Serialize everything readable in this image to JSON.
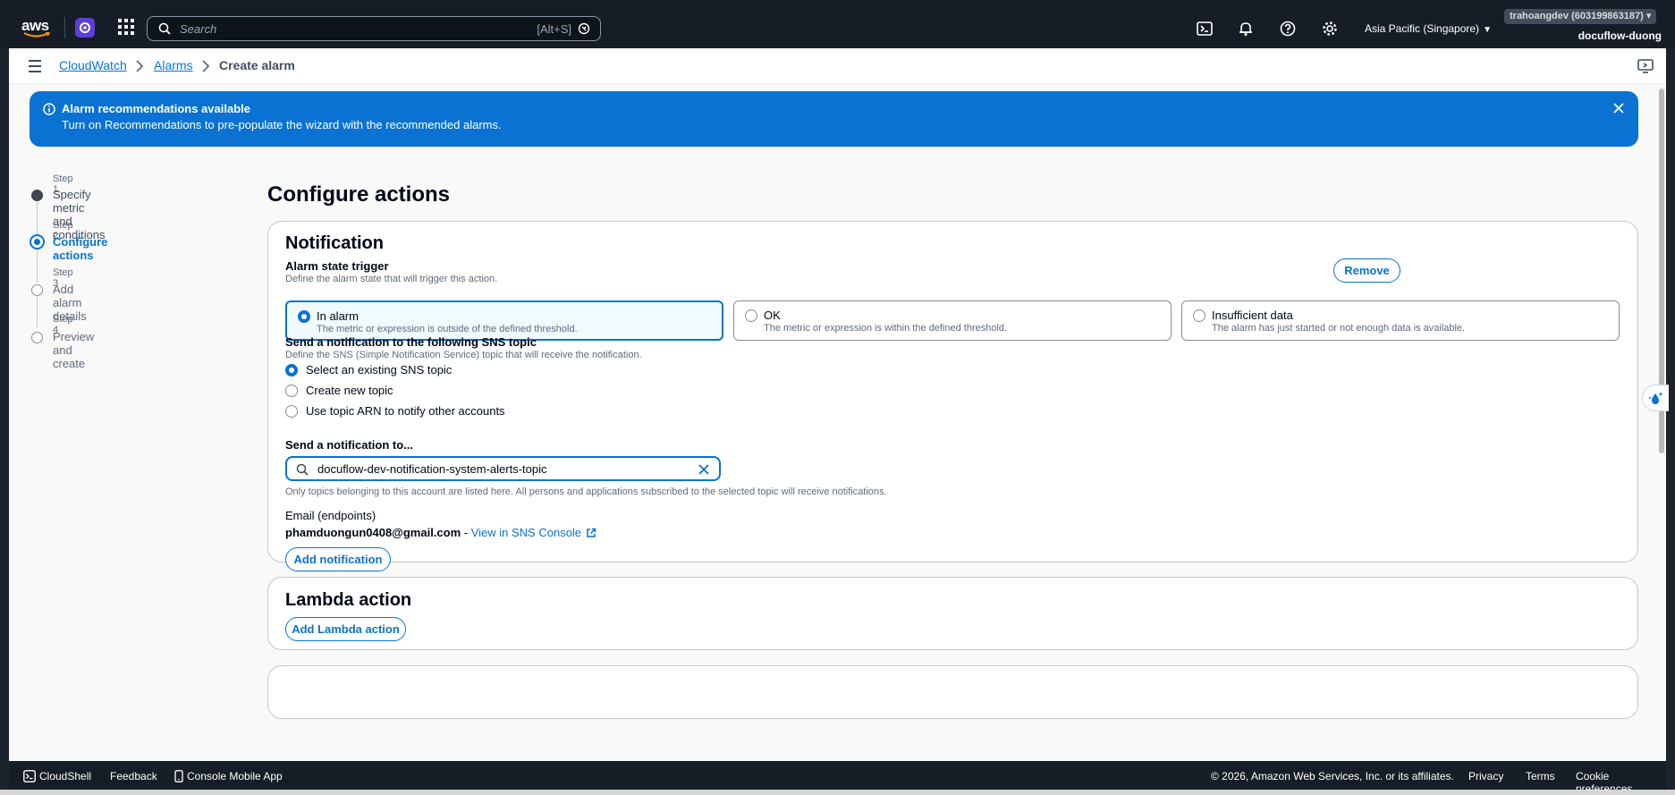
{
  "topnav": {
    "logo": "aws",
    "search_placeholder": "Search",
    "search_shortcut": "[Alt+S]",
    "region": "Asia Pacific (Singapore)",
    "account": "trahoangdev (603199863187)",
    "account_sub": "docuflow-duong",
    "icons": [
      "cloudshell-icon",
      "bell-icon",
      "help-icon",
      "gear-icon"
    ]
  },
  "breadcrumb": {
    "items": [
      "CloudWatch",
      "Alarms"
    ],
    "current": "Create alarm"
  },
  "flash": {
    "title": "Alarm recommendations available",
    "message": "Turn on Recommendations to pre-populate the wizard with the recommended alarms.",
    "color": "#0972d3"
  },
  "steps": [
    {
      "num": "Step 1",
      "label": "Specify metric and conditions",
      "state": "done"
    },
    {
      "num": "Step 2",
      "label": "Configure actions",
      "state": "current"
    },
    {
      "num": "Step 3",
      "label": "Add alarm details",
      "state": "upcoming"
    },
    {
      "num": "Step 4",
      "label": "Preview and create",
      "state": "upcoming"
    }
  ],
  "page_title": "Configure actions",
  "notification": {
    "heading": "Notification",
    "remove_label": "Remove",
    "trigger_label": "Alarm state trigger",
    "trigger_desc": "Define the alarm state that will trigger this action.",
    "states": [
      {
        "title": "In alarm",
        "desc": "The metric or expression is outside of the defined threshold.",
        "selected": true
      },
      {
        "title": "OK",
        "desc": "The metric or expression is within the defined threshold.",
        "selected": false
      },
      {
        "title": "Insufficient data",
        "desc": "The alarm has just started or not enough data is available.",
        "selected": false
      }
    ],
    "sns_label": "Send a notification to the following SNS topic",
    "sns_desc": "Define the SNS (Simple Notification Service) topic that will receive the notification.",
    "sns_options": [
      {
        "label": "Select an existing SNS topic",
        "selected": true
      },
      {
        "label": "Create new topic",
        "selected": false
      },
      {
        "label": "Use topic ARN to notify other accounts",
        "selected": false
      }
    ],
    "send_to_label": "Send a notification to...",
    "topic_value": "docuflow-dev-notification-system-alerts-topic",
    "topic_hint": "Only topics belonging to this account are listed here. All persons and applications subscribed to the selected topic will receive notifications.",
    "endpoints_label": "Email (endpoints)",
    "email": "phamduongun0408@gmail.com",
    "email_sep": " - ",
    "sns_console_link": "View in SNS Console",
    "add_notification": "Add notification"
  },
  "lambda": {
    "heading": "Lambda action",
    "add_label": "Add Lambda action"
  },
  "footer": {
    "cloudshell": "CloudShell",
    "feedback": "Feedback",
    "mobile_app": "Console Mobile App",
    "copyright": "© 2026, Amazon Web Services, Inc. or its affiliates.",
    "privacy": "Privacy",
    "terms": "Terms",
    "cookies": "Cookie preferences"
  }
}
